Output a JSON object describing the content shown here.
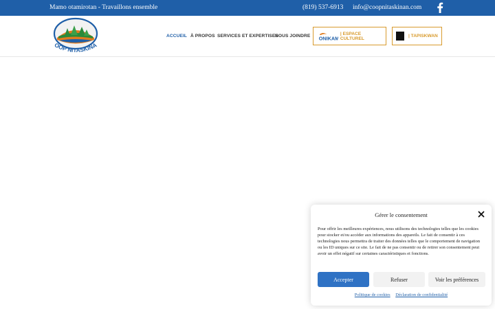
{
  "topbar": {
    "tagline": "Mamo otamirotan - Travaillons ensemble",
    "phone": "(819) 537-6913",
    "email": "info@coopnitaskinan.com",
    "social_icon": "facebook-icon"
  },
  "logo": {
    "text": "COOP NITASKINAN"
  },
  "nav": {
    "items": [
      {
        "label": "ACCUEIL",
        "active": true
      },
      {
        "label": "À PROPOS"
      },
      {
        "label": "SERVICES ET EXPERTISES"
      },
      {
        "label": "NOUS JOINDRE"
      }
    ],
    "espace_label": "| ESPACE CULTUREL",
    "onikam_logo_text": "ONIKAM",
    "tapiskwan_label": "| TAPISKWAN"
  },
  "consent": {
    "title": "Gérer le consentement",
    "body": "Pour offrir les meilleures expériences, nous utilisons des technologies telles que les cookies pour stocker et/ou accéder aux informations des appareils. Le fait de consentir à ces technologies nous permettra de traiter des données telles que le comportement de navigation ou les ID uniques sur ce site. Le fait de ne pas consentir ou de retirer son consentement peut avoir un effet négatif sur certaines caractéristiques et fonctions.",
    "accept": "Accepter",
    "refuse": "Refuser",
    "prefs": "Voir les préférences",
    "cookie_policy": "Politique de cookies",
    "privacy": "Déclaration de confidentialité"
  },
  "colors": {
    "topbar": "#1f5fa8",
    "accent_orange": "#d89a2c",
    "accept_button": "#2f72c4"
  }
}
